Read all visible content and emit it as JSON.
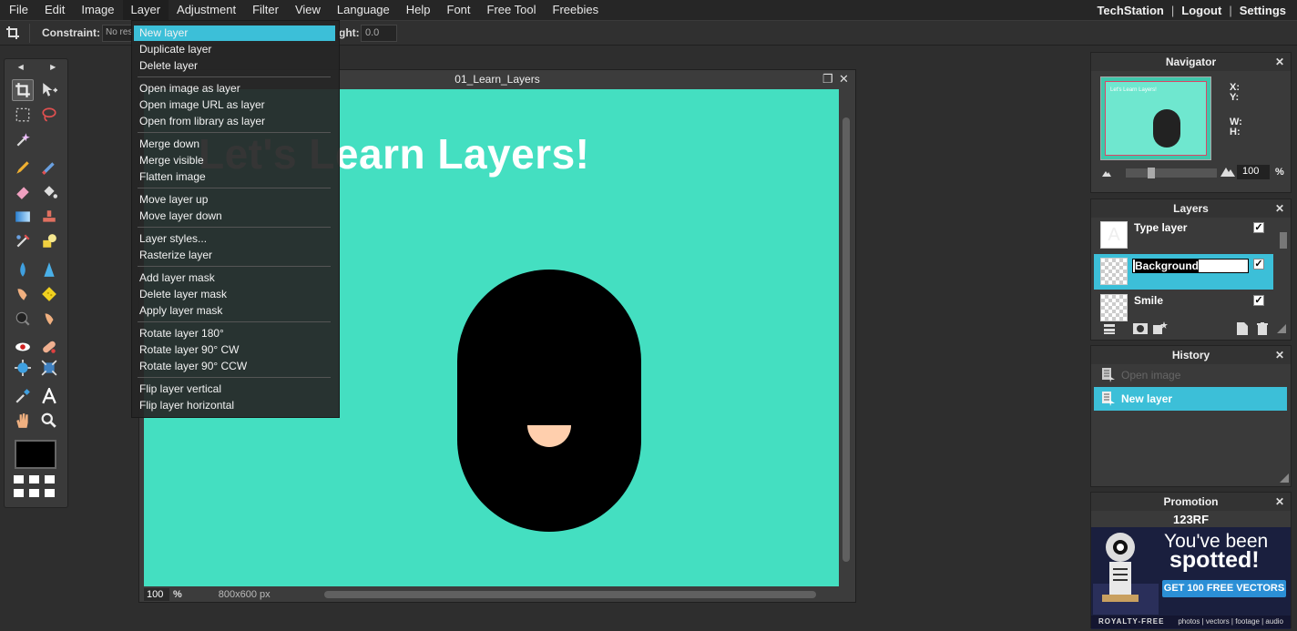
{
  "menubar": {
    "items": [
      "File",
      "Edit",
      "Image",
      "Layer",
      "Adjustment",
      "Filter",
      "View",
      "Language",
      "Help",
      "Font",
      "Free Tool",
      "Freebies"
    ],
    "user": "TechStation",
    "logout": "Logout",
    "settings": "Settings",
    "separator": "|"
  },
  "optbar": {
    "constraint_label": "Constraint:",
    "constraint_value": "No res",
    "height_label": "ght:",
    "height_value": "0.0"
  },
  "layer_menu": {
    "items": [
      "New layer",
      "Duplicate layer",
      "Delete layer",
      "Open image as layer",
      "Open image URL as layer",
      "Open from library as layer",
      "Merge down",
      "Merge visible",
      "Flatten image",
      "Move layer up",
      "Move layer down",
      "Layer styles...",
      "Rasterize layer",
      "Add layer mask",
      "Delete layer mask",
      "Apply layer mask",
      "Rotate layer 180°",
      "Rotate layer 90° CW",
      "Rotate layer 90° CCW",
      "Flip layer vertical",
      "Flip layer horizontal"
    ],
    "highlighted": "New layer"
  },
  "image_window": {
    "title": "01_Learn_Layers",
    "canvas_text": "Let's Learn Layers!",
    "canvas_color": "#44dfc1",
    "zoom": "100",
    "zoom_unit": "%",
    "dimensions": "800x600 px"
  },
  "navigator": {
    "title": "Navigator",
    "mini_text": "Let's Learn Layers!",
    "x_label": "X:",
    "y_label": "Y:",
    "w_label": "W:",
    "h_label": "H:",
    "zoom_value": "100",
    "zoom_unit": "%"
  },
  "layers": {
    "title": "Layers",
    "rows": [
      {
        "name": "Type layer"
      },
      {
        "name": "Background"
      },
      {
        "name": "Smile"
      }
    ],
    "type_thumb": "A",
    "check": "✓"
  },
  "history": {
    "title": "History",
    "items": [
      "Open image",
      "New layer"
    ]
  },
  "promotion": {
    "title": "Promotion",
    "logo": "123RF",
    "line1": "You've been",
    "line2": "spotted!",
    "button": "GET 100 FREE VECTORS",
    "foot_left": "ROYALTY-FREE",
    "foot_right": "photos | vectors | footage | audio"
  },
  "icons": {
    "close": "✕",
    "restore": "❐",
    "arrow_left": "◀",
    "arrow_right": "▶"
  },
  "colors": {
    "accent": "#3cbfd8",
    "canvas": "#44dfc1",
    "face": "#000000",
    "mouth": "#ffcfad"
  }
}
